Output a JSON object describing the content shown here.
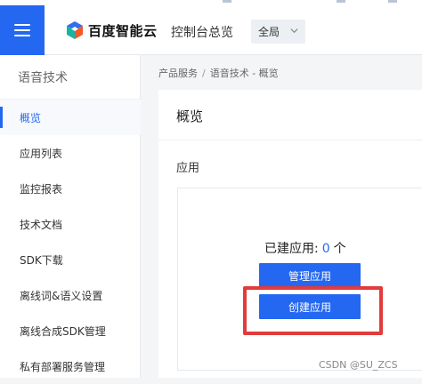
{
  "header": {
    "brand": "百度智能云",
    "console_title": "控制台总览",
    "region": "全局"
  },
  "sidebar": {
    "title": "语音技术",
    "items": [
      {
        "label": "概览"
      },
      {
        "label": "应用列表"
      },
      {
        "label": "监控报表"
      },
      {
        "label": "技术文档"
      },
      {
        "label": "SDK下载"
      },
      {
        "label": "离线词&语义设置"
      },
      {
        "label": "离线合成SDK管理"
      },
      {
        "label": "私有部署服务管理"
      }
    ]
  },
  "breadcrumb": {
    "root": "产品服务",
    "separator": "/",
    "current": "语音技术 - 概览"
  },
  "main": {
    "page_title": "概览",
    "section_title": "应用",
    "created_label": "已建应用:",
    "created_count": "0",
    "created_unit": "个",
    "manage_button": "管理应用",
    "create_button": "创建应用"
  },
  "watermark": "CSDN @SU_ZCS",
  "colors": {
    "primary": "#2468f2",
    "highlight": "#e23b3b"
  }
}
